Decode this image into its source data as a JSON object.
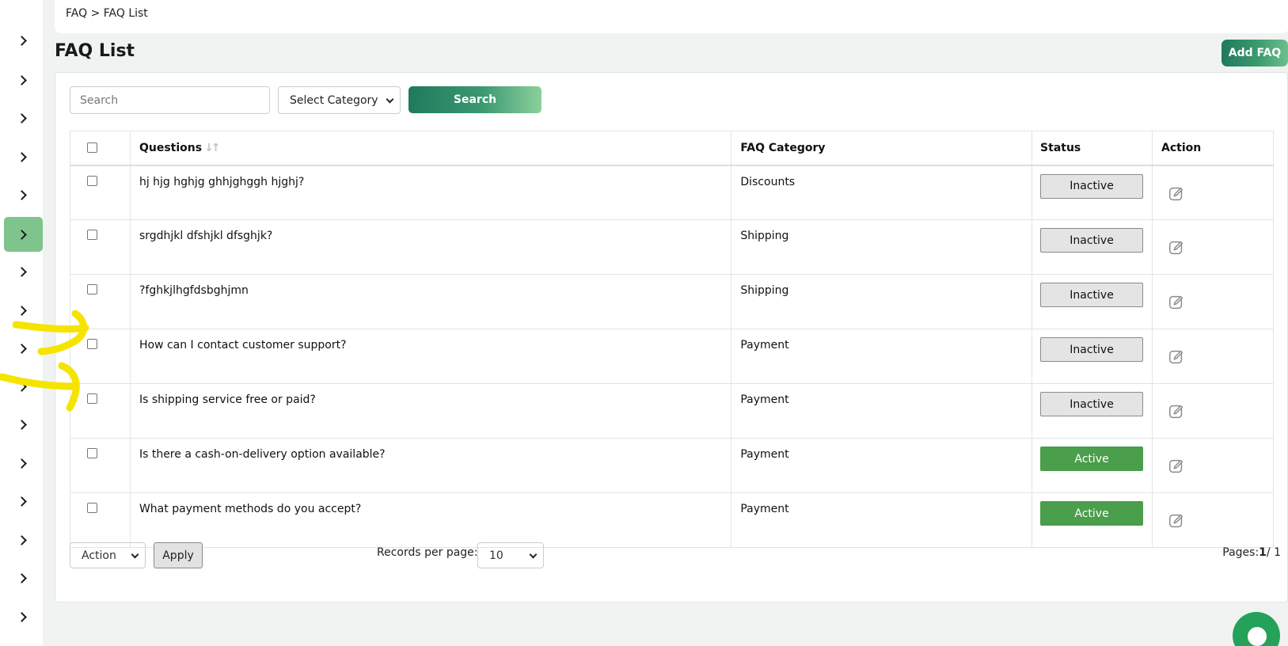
{
  "breadcrumb": "FAQ > FAQ List",
  "page_title": "FAQ List",
  "add_button_label": "Add FAQ",
  "filters": {
    "search_placeholder": "Search",
    "category_select": "Select Category",
    "search_button": "Search"
  },
  "table": {
    "headers": {
      "questions": "Questions",
      "category": "FAQ Category",
      "status": "Status",
      "action": "Action"
    },
    "rows": [
      {
        "question": "hj hjg hghjg ghhjghggh hjghj?",
        "category": "Discounts",
        "status": "Inactive"
      },
      {
        "question": "srgdhjkl dfshjkl dfsghjk?",
        "category": "Shipping",
        "status": "Inactive"
      },
      {
        "question": "?fghkjlhgfdsbghjmn",
        "category": "Shipping",
        "status": "Inactive"
      },
      {
        "question": "How can I contact customer support?",
        "category": "Payment",
        "status": "Inactive"
      },
      {
        "question": "Is shipping service free or paid?",
        "category": "Payment",
        "status": "Inactive"
      },
      {
        "question": "Is there a cash-on-delivery option available?",
        "category": "Payment",
        "status": "Active"
      },
      {
        "question": "What payment methods do you accept?",
        "category": "Payment",
        "status": "Active"
      }
    ]
  },
  "footer": {
    "action_select": "Action",
    "apply_button": "Apply",
    "records_label": "Records per page:",
    "records_value": "10",
    "pages_label": "Pages:",
    "pages_current": "1",
    "pages_total": "/ 1"
  },
  "colors": {
    "brand_green": "#1f7a5c",
    "active_green": "#4a9e4c",
    "sidebar_active": "#7fc48c",
    "annotation_yellow": "#f5e400"
  },
  "icons": {
    "sidebar": "chevron-right-icon",
    "edit": "edit-icon",
    "sort": "sort-icon",
    "chat": "chat-icon"
  }
}
